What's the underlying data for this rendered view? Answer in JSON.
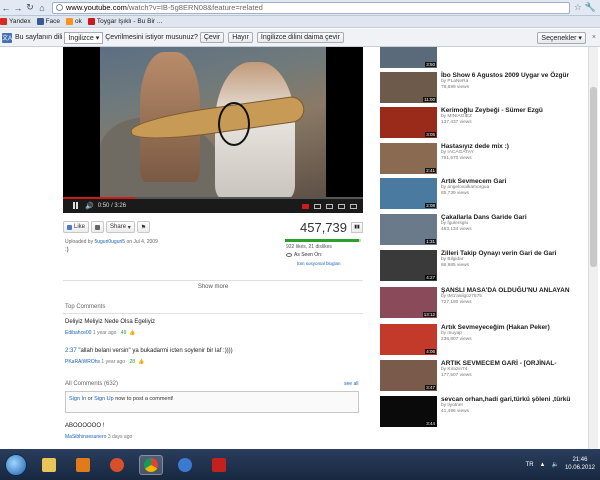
{
  "browser": {
    "url_host": "www.youtube.com",
    "url_path": "/watch?v=IB-5g8ERN08&feature=related",
    "bookmarks": [
      {
        "label": "Yandex",
        "color": "#d52b1e"
      },
      {
        "label": "Face",
        "color": "#3b5998"
      },
      {
        "label": "ok",
        "color": "#f7931e"
      },
      {
        "label": "Toygar Işıklı - Bu Bir ...",
        "color": "#cc181e"
      }
    ]
  },
  "translate_bar": {
    "prompt": "Bu sayfanın dili",
    "language": "İngilizce",
    "question": "Çevrilmesini istiyor musunuz?",
    "translate_button": "Çevir",
    "no_button": "Hayır",
    "never_button": "İngilizce dilini daima çevir",
    "options_button": "Seçenekler",
    "close": "×"
  },
  "player": {
    "current_time": "0:50",
    "duration": "3:26",
    "progress": 0.24
  },
  "actions": {
    "like": "Like",
    "share": "Share",
    "view_count": "457,739"
  },
  "uploader": {
    "prefix": "Uploaded by",
    "name": "5uguri0uguri5",
    "date_prefix": "on",
    "date": "Jul 4, 2009",
    "description": ":)"
  },
  "ratings": {
    "likes_text": "922 likes, 21 dislikes",
    "like_ratio": 0.978,
    "as_seen_on": "As Seen On:",
    "social_link": "tüm sosyomal bloglan"
  },
  "show_more": "Show more",
  "top_comments": {
    "heading": "Top Comments",
    "items": [
      {
        "text": "Deliyiz Meliyiz Nede Olsa Egeliyiz",
        "user": "Edibahce00",
        "time": "1 year ago",
        "score": "49"
      },
      {
        "time_link": "2:37",
        "text": "\"allah belani versin\" ya bukadarmi icten soylenir bir laf :))))",
        "user": "PKaRAiWROhs",
        "time": "1 year ago",
        "score": "28"
      }
    ]
  },
  "all_comments": {
    "heading": "All Comments (632)",
    "see_all": "see all",
    "signin": "Sign In",
    "or": "or",
    "signup": "Sign Up",
    "signin_rest": "now to post a comment!",
    "first_comment": {
      "text": "ABOOOOOO !",
      "user": "MaSibhinsesunero",
      "time": "3 days ago"
    }
  },
  "sidebar": {
    "items": [
      {
        "title": "",
        "by": "",
        "views": "41,746 views",
        "duration": "3:50",
        "color": "#5a6a7a"
      },
      {
        "title": "İbo Show 6 Agustos 2009 Uygar ve Özgür",
        "by": "by PLaNeRa",
        "views": "78,699 views",
        "duration": "11:00",
        "color": "#6d5a4a"
      },
      {
        "title": "Kerimoğlu Zeybeği - Sümer Ezgü",
        "by": "by MINIAGIEZ",
        "views": "137,437 views",
        "duration": "3:05",
        "color": "#9a2a1a"
      },
      {
        "title": "Hastasıyız dede mix :)",
        "by": "by IACAGATAY",
        "views": "791,670 views",
        "duration": "2:41",
        "color": "#8a6a50"
      },
      {
        "title": "Artık Sevmecem Gari",
        "by": "by angelovalkamorgua",
        "views": "85,739 views",
        "duration": "2:08",
        "color": "#4a7aa0"
      },
      {
        "title": "Çakallarla Dans Garide Gari",
        "by": "by fgulersglu",
        "views": "483,134 views",
        "duration": "1:31",
        "color": "#6a7a8a"
      },
      {
        "title": "Zilleri Takip Oynayı verin Gari de Gari",
        "by": "by Bilgidar",
        "views": "86,985 views",
        "duration": "4:27",
        "color": "#3a3a3a"
      },
      {
        "title": "ŞANSLI MASA'DA OLDUĞU'NU ANLAYAN",
        "by": "by tM1'asilgoz7575",
        "views": "727,180 views",
        "duration": "13:12",
        "color": "#8a4a5a"
      },
      {
        "title": "Artık Sevmeyeceğim (Hakan Peker)",
        "by": "by muyap",
        "views": "236,807 views",
        "duration": "4:06",
        "color": "#c43a2a"
      },
      {
        "title": "ARTIK SEVMECEM GARİ - [ORJİNAL-",
        "by": "by Kirazin74",
        "views": "177,507 views",
        "duration": "3:47",
        "color": "#7a5a4a"
      },
      {
        "title": "sevcan orhan,hadi gari,türkü şöleni ,türkü",
        "by": "by tiyotner",
        "views": "41,496 views",
        "duration": "3:44",
        "color": "#0a0a0a"
      }
    ]
  },
  "taskbar": {
    "language": "TR",
    "time": "21:46",
    "date": "10.06.2012"
  }
}
